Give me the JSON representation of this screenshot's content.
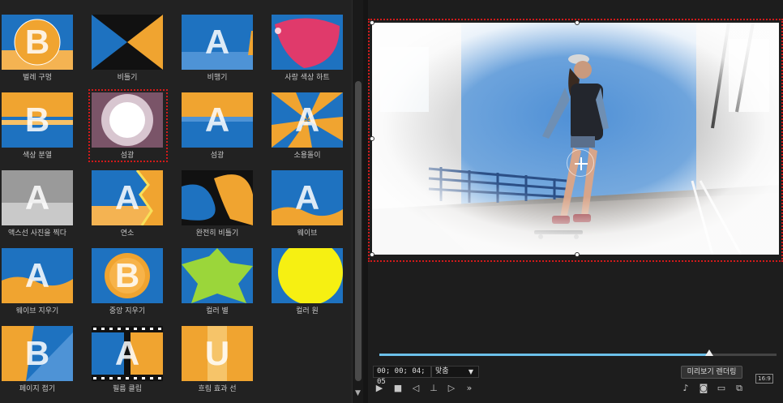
{
  "effects": [
    {
      "label": "벌레 구멍",
      "letter": "B"
    },
    {
      "label": "비틀기",
      "letter": ""
    },
    {
      "label": "비행기",
      "letter": "A"
    },
    {
      "label": "사랑 색상 하트",
      "letter": ""
    },
    {
      "label": "색상 분열",
      "letter": "B"
    },
    {
      "label": "섬광",
      "letter": "",
      "selected": true
    },
    {
      "label": "섬광",
      "letter": "A"
    },
    {
      "label": "소용돌이",
      "letter": "A"
    },
    {
      "label": "액스선 사진을 찍다",
      "letter": "A"
    },
    {
      "label": "연소",
      "letter": "A"
    },
    {
      "label": "완전히 비틀기",
      "letter": ""
    },
    {
      "label": "웨이브",
      "letter": "A"
    },
    {
      "label": "웨이브 지우기",
      "letter": "A"
    },
    {
      "label": "중앙 지우기",
      "letter": "B"
    },
    {
      "label": "컬러 별",
      "letter": ""
    },
    {
      "label": "컬러 원",
      "letter": ""
    },
    {
      "label": "페이지 접기",
      "letter": "B"
    },
    {
      "label": "필름 클립",
      "letter": "A"
    },
    {
      "label": "흐림 효과 선",
      "letter": "U"
    }
  ],
  "preview": {
    "timecode": "00; 00; 04; 05",
    "fit_label": "맞춤",
    "render_label": "미리보기 렌더링",
    "aspect_label": "16:9",
    "progress": 0.83
  },
  "colors": {
    "accent": "#6cc0ea",
    "selection": "#d21a1a",
    "orange": "#f0a430",
    "blue": "#1e72c0"
  }
}
